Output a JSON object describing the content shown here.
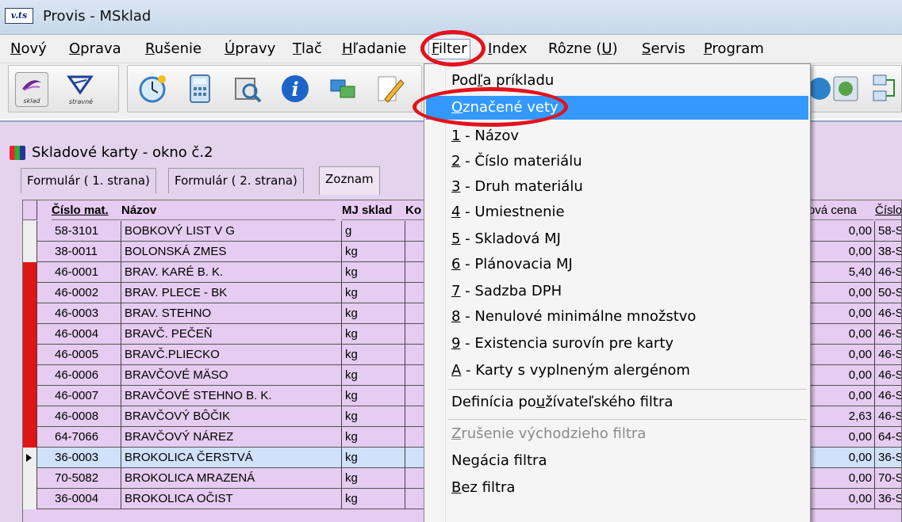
{
  "window": {
    "logo_text": "v.ts",
    "title": "Provis - MSklad"
  },
  "menubar": [
    {
      "pre": "",
      "u": "N",
      "post": "ový"
    },
    {
      "pre": "",
      "u": "O",
      "post": "prava"
    },
    {
      "pre": "",
      "u": "R",
      "post": "ušenie"
    },
    {
      "pre": "",
      "u": "Ú",
      "post": "pravy"
    },
    {
      "pre": "",
      "u": "T",
      "post": "lač"
    },
    {
      "pre": "",
      "u": "H",
      "post": "ľadanie"
    },
    {
      "pre": "",
      "u": "F",
      "post": "ilter"
    },
    {
      "pre": "",
      "u": "I",
      "post": "ndex"
    },
    {
      "pre": "Rôzne (",
      "u": "U",
      "post": ")"
    },
    {
      "pre": "",
      "u": "S",
      "post": "ervis"
    },
    {
      "pre": "",
      "u": "P",
      "post": "rogram"
    }
  ],
  "toolbar": {
    "sklad_label": "sklad",
    "stravne_label": "stravné"
  },
  "mdi_window": {
    "title": "Skladové karty - okno č.2",
    "tabs": [
      "Formulár ( 1. strana)",
      "Formulár ( 2. strana)",
      "Zoznam"
    ],
    "active_tab": "Zoznam"
  },
  "table": {
    "headers": {
      "cislo": "Číslo mat.",
      "nazov": "Názov",
      "mj": "MJ sklad",
      "ko": "Ko",
      "cena": "ová cena",
      "cislo2": "Číslo"
    },
    "rows": [
      {
        "cislo": "58-3101",
        "nazov": "BOBKOVÝ LIST V G",
        "mj": "g",
        "cena": "0,00",
        "c2": "58-S",
        "flag": false
      },
      {
        "cislo": "38-0011",
        "nazov": "BOLONSKÁ ZMES",
        "mj": "kg",
        "cena": "0,00",
        "c2": "38-S",
        "flag": false
      },
      {
        "cislo": "46-0001",
        "nazov": "BRAV. KARÉ B. K.",
        "mj": "kg",
        "cena": "5,40",
        "c2": "46-S",
        "flag": true
      },
      {
        "cislo": "46-0002",
        "nazov": "BRAV. PLECE - BK",
        "mj": "kg",
        "cena": "0,00",
        "c2": "50-S",
        "flag": true
      },
      {
        "cislo": "46-0003",
        "nazov": "BRAV. STEHNO",
        "mj": "kg",
        "cena": "0,00",
        "c2": "46-S",
        "flag": true
      },
      {
        "cislo": "46-0004",
        "nazov": "BRAVČ. PEČEŇ",
        "mj": "kg",
        "cena": "0,00",
        "c2": "46-S",
        "flag": true
      },
      {
        "cislo": "46-0005",
        "nazov": "BRAVČ.PLIECKO",
        "mj": "kg",
        "cena": "0,00",
        "c2": "46-S",
        "flag": true
      },
      {
        "cislo": "46-0006",
        "nazov": "BRAVČOVÉ MÄSO",
        "mj": "kg",
        "cena": "0,00",
        "c2": "46-S",
        "flag": true
      },
      {
        "cislo": "46-0007",
        "nazov": "BRAVČOVÉ STEHNO B. K.",
        "mj": "kg",
        "cena": "0,00",
        "c2": "46-S",
        "flag": true
      },
      {
        "cislo": "46-0008",
        "nazov": "BRAVČOVÝ BÔČIK",
        "mj": "kg",
        "cena": "2,63",
        "c2": "46-S",
        "flag": true
      },
      {
        "cislo": "64-7066",
        "nazov": "BRAVČOVÝ NÁREZ",
        "mj": "kg",
        "cena": "0,00",
        "c2": "64-S",
        "flag": true
      },
      {
        "cislo": "36-0003",
        "nazov": "BROKOLICA ČERSTVÁ",
        "mj": "kg",
        "cena": "0,00",
        "c2": "36-S",
        "flag": false,
        "selected": true
      },
      {
        "cislo": "70-5082",
        "nazov": "BROKOLICA MRAZENÁ",
        "mj": "kg",
        "cena": "0,00",
        "c2": "70-S",
        "flag": false
      },
      {
        "cislo": "36-0004",
        "nazov": "BROKOLICA OČIST",
        "mj": "kg",
        "cena": "0,00",
        "c2": "36-S",
        "flag": false
      }
    ]
  },
  "filter_menu": [
    {
      "pre": "Pod",
      "u": "ľ",
      "post": "a príkladu",
      "state": "normal"
    },
    {
      "pre": "",
      "u": "O",
      "post": "značené vety",
      "state": "hover"
    },
    {
      "pre": "",
      "u": "1",
      "post": " - Názov",
      "state": "normal"
    },
    {
      "pre": "",
      "u": "2",
      "post": " - Číslo materiálu",
      "state": "normal"
    },
    {
      "pre": "",
      "u": "3",
      "post": " - Druh materiálu",
      "state": "normal"
    },
    {
      "pre": "",
      "u": "4",
      "post": " - Umiestnenie",
      "state": "normal"
    },
    {
      "pre": "",
      "u": "5",
      "post": " - Skladová MJ",
      "state": "normal"
    },
    {
      "pre": "",
      "u": "6",
      "post": " - Plánovacia MJ",
      "state": "normal"
    },
    {
      "pre": "",
      "u": "7",
      "post": " - Sadzba DPH",
      "state": "normal"
    },
    {
      "pre": "",
      "u": "8",
      "post": " - Nenulové minimálne množstvo",
      "state": "normal"
    },
    {
      "pre": "",
      "u": "9",
      "post": " - Existencia surovín pre karty",
      "state": "normal"
    },
    {
      "pre": "",
      "u": "A",
      "post": " - Karty s vyplneným alergénom",
      "state": "normal"
    },
    {
      "pre": "Definícia po",
      "u": "u",
      "post": "žívateľského filtra",
      "state": "normal"
    },
    {
      "pre": "",
      "u": "Z",
      "post": "rušenie východzieho filtra",
      "state": "disabled"
    },
    {
      "pre": "Negácia filtra",
      "u": "",
      "post": "",
      "state": "normal"
    },
    {
      "pre": "",
      "u": "B",
      "post": "ez filtra",
      "state": "normal"
    }
  ]
}
